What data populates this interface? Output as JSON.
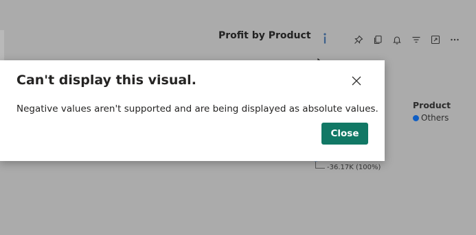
{
  "visual": {
    "title": "Profit by Product",
    "toolbar_icons": [
      "pin-icon",
      "copy-icon",
      "bell-icon",
      "filter-icon",
      "focus-mode-icon",
      "more-options-icon"
    ]
  },
  "legend": {
    "title": "Product",
    "items": [
      {
        "label": "Others",
        "color": "#0f5ec4"
      }
    ]
  },
  "chart": {
    "data_label": "-36.17K (100%)"
  },
  "dialog": {
    "title": "Can't display this visual.",
    "message": "Negative values aren't supported and are being displayed as absolute values.",
    "close_label": "Close",
    "button_color": "#117865"
  },
  "colors": {
    "overlay": "#ababab",
    "dialog_bg": "#ffffff",
    "primary_button": "#117865"
  }
}
